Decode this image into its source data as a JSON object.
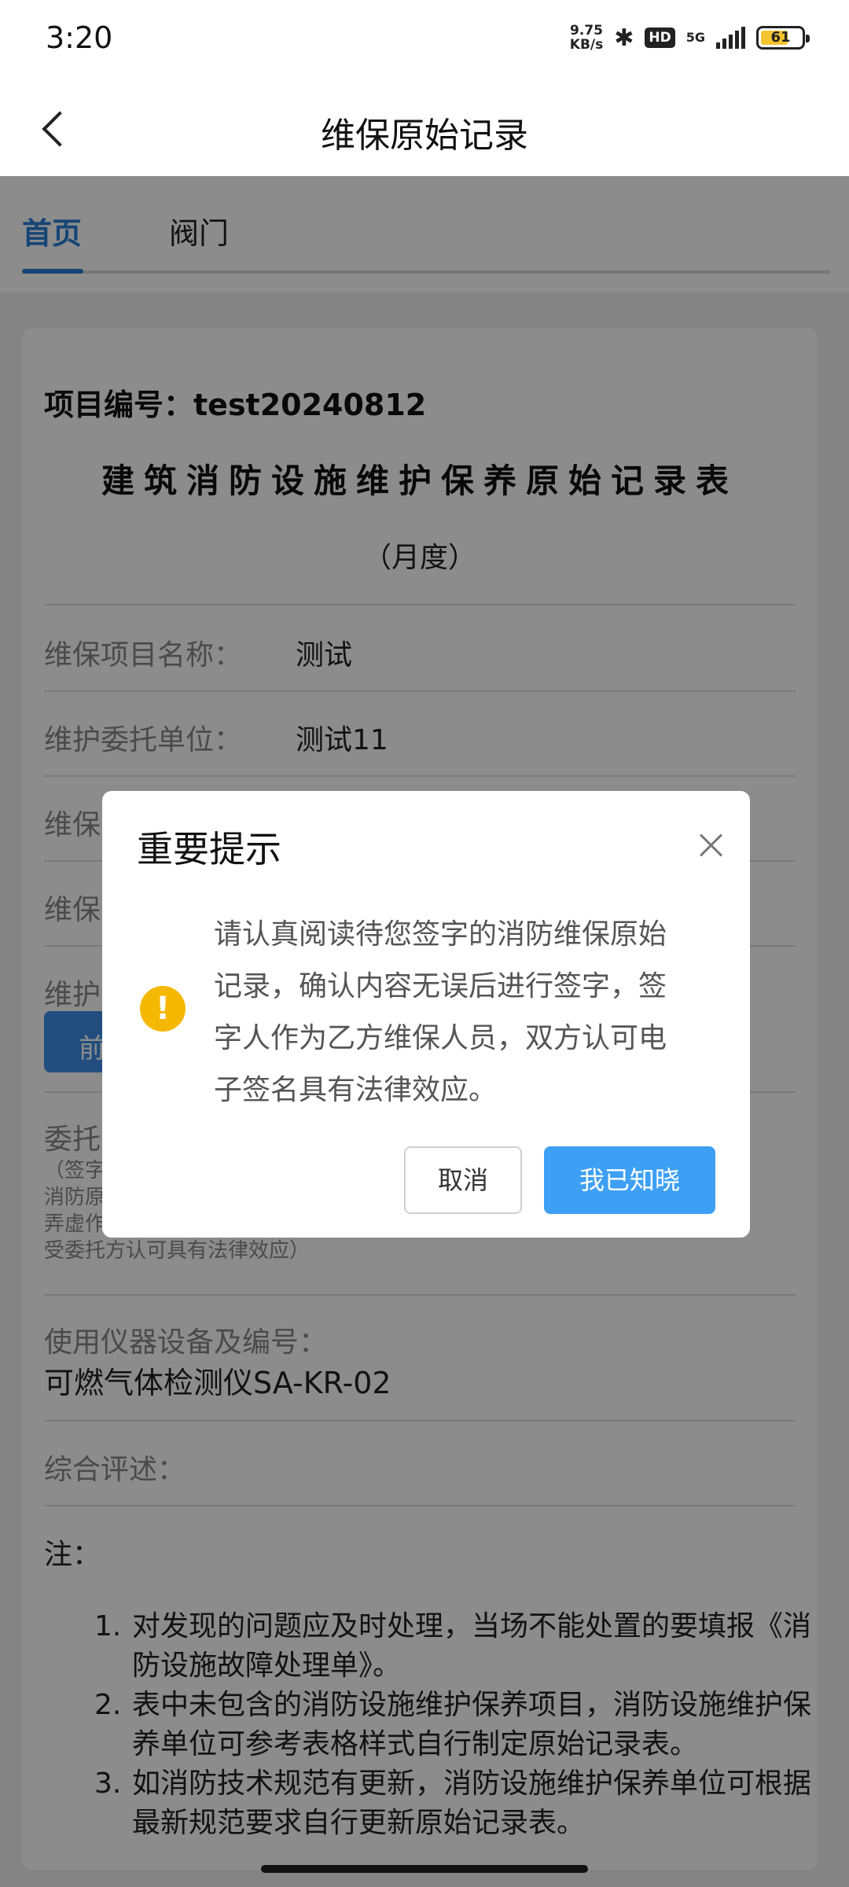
{
  "status_bar": {
    "time": "3:20",
    "net_speed_value": "9.75",
    "net_speed_unit": "KB/s",
    "hd": "HD",
    "network": "5G",
    "battery": "61"
  },
  "nav": {
    "title": "维保原始记录"
  },
  "tabs": [
    {
      "label": "首页",
      "active": true
    },
    {
      "label": "阀门",
      "active": false
    }
  ],
  "card": {
    "project_no": "项目编号：test20240812",
    "form_title": "建筑消防设施维护保养原始记录表",
    "form_subtitle": "（月度）",
    "rows": [
      {
        "label": "维保项目名称：",
        "value": "测试"
      },
      {
        "label": "维护委托单位：",
        "value": "测试11"
      },
      {
        "label": "维保",
        "value": ""
      },
      {
        "label": "维保",
        "value": ""
      },
      {
        "label": "维护",
        "value": ""
      }
    ],
    "prev_button": "前",
    "entrust_label": "委托",
    "entrust_note_lines": [
      "（签字",
      "消防原",
      "弄虚作",
      "受委托方认可具有法律效应）"
    ],
    "instrument_label": "使用仪器设备及编号：",
    "instrument_value": "可燃气体检测仪SA-KR-02",
    "summary_label": "综合评述：",
    "note_title": "注：",
    "notes": [
      {
        "num": "1.",
        "text": "对发现的问题应及时处理，当场不能处置的要填报《消防设施故障处理单》。"
      },
      {
        "num": "2.",
        "text": "表中未包含的消防设施维护保养项目，消防设施维护保养单位可参考表格样式自行制定原始记录表。"
      },
      {
        "num": "3.",
        "text": "如消防技术规范有更新，消防设施维护保养单位可根据最新规范要求自行更新原始记录表。"
      }
    ]
  },
  "dialog": {
    "title": "重要提示",
    "message": "请认真阅读待您签字的消防维保原始记录，确认内容无误后进行签字，签字人作为乙方维保人员，双方认可电子签名具有法律效应。",
    "cancel_label": "取消",
    "confirm_label": "我已知晓"
  },
  "colors": {
    "accent": "#2b7fd8",
    "confirm_button": "#3ea0f5",
    "warning": "#f5b800"
  },
  "icons": [
    "back-arrow-icon",
    "close-icon",
    "warning-icon",
    "bluetooth-icon",
    "signal-icon",
    "battery-icon"
  ]
}
